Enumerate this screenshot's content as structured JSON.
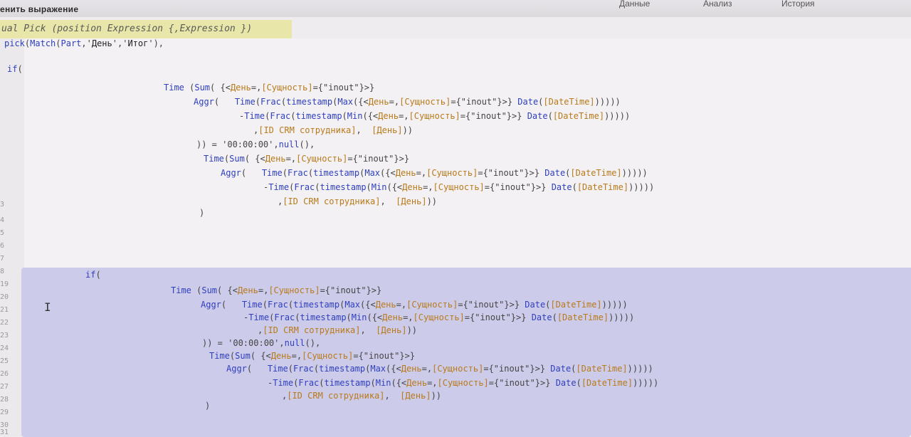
{
  "dialog": {
    "title": "енить выражение",
    "tabs": [
      "Данные",
      "Анализ",
      "История"
    ]
  },
  "hint": "ual Pick (position Expression {,Expression })",
  "colors": {
    "keyword": "#2e3fbf",
    "field": "#b87a1a",
    "selection": "#cdcbea",
    "hint_bg": "#e8e6a8"
  },
  "gutter": {
    "line_numbers": [
      "3",
      "4",
      "5",
      "6",
      "7",
      "8",
      "19",
      "20",
      "21",
      "22",
      "23",
      "24",
      "25",
      "26",
      "27",
      "28",
      "29",
      "30",
      "31"
    ]
  },
  "code": {
    "line1": [
      {
        "c": "fn",
        "t": "pick"
      },
      {
        "c": "txt",
        "t": "("
      },
      {
        "c": "fn",
        "t": "Match"
      },
      {
        "c": "txt",
        "t": "("
      },
      {
        "c": "fn",
        "t": "Part"
      },
      {
        "c": "txt",
        "t": ",'"
      },
      {
        "c": "str",
        "t": "День"
      },
      {
        "c": "txt",
        "t": "','"
      },
      {
        "c": "str",
        "t": "Итог"
      },
      {
        "c": "txt",
        "t": "'),"
      }
    ],
    "line2": [
      {
        "c": "kw",
        "t": "if"
      },
      {
        "c": "txt",
        "t": "("
      }
    ],
    "block_a": [
      [
        {
          "c": "fn",
          "t": "Time"
        },
        {
          "c": "txt",
          "t": " ("
        },
        {
          "c": "fn",
          "t": "Sum"
        },
        {
          "c": "txt",
          "t": "( {<"
        },
        {
          "c": "fld",
          "t": "День"
        },
        {
          "c": "txt",
          "t": "=,"
        },
        {
          "c": "fld",
          "t": "[Сущность]"
        },
        {
          "c": "txt",
          "t": "={\"inout\"}>}"
        }
      ],
      [
        {
          "c": "fn",
          "t": "Aggr"
        },
        {
          "c": "txt",
          "t": "(   "
        },
        {
          "c": "fn",
          "t": "Time"
        },
        {
          "c": "txt",
          "t": "("
        },
        {
          "c": "fn",
          "t": "Frac"
        },
        {
          "c": "txt",
          "t": "("
        },
        {
          "c": "fn",
          "t": "timestamp"
        },
        {
          "c": "txt",
          "t": "("
        },
        {
          "c": "fn",
          "t": "Max"
        },
        {
          "c": "txt",
          "t": "({<"
        },
        {
          "c": "fld",
          "t": "День"
        },
        {
          "c": "txt",
          "t": "=,"
        },
        {
          "c": "fld",
          "t": "[Сущность]"
        },
        {
          "c": "txt",
          "t": "={\"inout\"}>} "
        },
        {
          "c": "fn",
          "t": "Date"
        },
        {
          "c": "txt",
          "t": "("
        },
        {
          "c": "fld",
          "t": "[DateTime]"
        },
        {
          "c": "txt",
          "t": ")))))"
        }
      ],
      [
        {
          "c": "txt",
          "t": "-"
        },
        {
          "c": "fn",
          "t": "Time"
        },
        {
          "c": "txt",
          "t": "("
        },
        {
          "c": "fn",
          "t": "Frac"
        },
        {
          "c": "txt",
          "t": "("
        },
        {
          "c": "fn",
          "t": "timestamp"
        },
        {
          "c": "txt",
          "t": "("
        },
        {
          "c": "fn",
          "t": "Min"
        },
        {
          "c": "txt",
          "t": "({<"
        },
        {
          "c": "fld",
          "t": "День"
        },
        {
          "c": "txt",
          "t": "=,"
        },
        {
          "c": "fld",
          "t": "[Сущность]"
        },
        {
          "c": "txt",
          "t": "={\"inout\"}>} "
        },
        {
          "c": "fn",
          "t": "Date"
        },
        {
          "c": "txt",
          "t": "("
        },
        {
          "c": "fld",
          "t": "[DateTime]"
        },
        {
          "c": "txt",
          "t": ")))))"
        }
      ],
      [
        {
          "c": "txt",
          "t": ","
        },
        {
          "c": "fld",
          "t": "[ID CRM сотрудника]"
        },
        {
          "c": "txt",
          "t": ",  "
        },
        {
          "c": "fld",
          "t": "[День]"
        },
        {
          "c": "txt",
          "t": "))"
        }
      ],
      [
        {
          "c": "txt",
          "t": ")) = '00:00:00',"
        },
        {
          "c": "fn",
          "t": "null"
        },
        {
          "c": "txt",
          "t": "(),"
        }
      ],
      [
        {
          "c": "fn",
          "t": "Time"
        },
        {
          "c": "txt",
          "t": "("
        },
        {
          "c": "fn",
          "t": "Sum"
        },
        {
          "c": "txt",
          "t": "( {<"
        },
        {
          "c": "fld",
          "t": "День"
        },
        {
          "c": "txt",
          "t": "=,"
        },
        {
          "c": "fld",
          "t": "[Сущность]"
        },
        {
          "c": "txt",
          "t": "={\"inout\"}>}"
        }
      ],
      [
        {
          "c": "fn",
          "t": "Aggr"
        },
        {
          "c": "txt",
          "t": "(   "
        },
        {
          "c": "fn",
          "t": "Time"
        },
        {
          "c": "txt",
          "t": "("
        },
        {
          "c": "fn",
          "t": "Frac"
        },
        {
          "c": "txt",
          "t": "("
        },
        {
          "c": "fn",
          "t": "timestamp"
        },
        {
          "c": "txt",
          "t": "("
        },
        {
          "c": "fn",
          "t": "Max"
        },
        {
          "c": "txt",
          "t": "({<"
        },
        {
          "c": "fld",
          "t": "День"
        },
        {
          "c": "txt",
          "t": "=,"
        },
        {
          "c": "fld",
          "t": "[Сущность]"
        },
        {
          "c": "txt",
          "t": "={\"inout\"}>} "
        },
        {
          "c": "fn",
          "t": "Date"
        },
        {
          "c": "txt",
          "t": "("
        },
        {
          "c": "fld",
          "t": "[DateTime]"
        },
        {
          "c": "txt",
          "t": ")))))"
        }
      ],
      [
        {
          "c": "txt",
          "t": "-"
        },
        {
          "c": "fn",
          "t": "Time"
        },
        {
          "c": "txt",
          "t": "("
        },
        {
          "c": "fn",
          "t": "Frac"
        },
        {
          "c": "txt",
          "t": "("
        },
        {
          "c": "fn",
          "t": "timestamp"
        },
        {
          "c": "txt",
          "t": "("
        },
        {
          "c": "fn",
          "t": "Min"
        },
        {
          "c": "txt",
          "t": "({<"
        },
        {
          "c": "fld",
          "t": "День"
        },
        {
          "c": "txt",
          "t": "=,"
        },
        {
          "c": "fld",
          "t": "[Сущность]"
        },
        {
          "c": "txt",
          "t": "={\"inout\"}>} "
        },
        {
          "c": "fn",
          "t": "Date"
        },
        {
          "c": "txt",
          "t": "("
        },
        {
          "c": "fld",
          "t": "[DateTime]"
        },
        {
          "c": "txt",
          "t": ")))))"
        }
      ],
      [
        {
          "c": "txt",
          "t": ","
        },
        {
          "c": "fld",
          "t": "[ID CRM сотрудника]"
        },
        {
          "c": "txt",
          "t": ",  "
        },
        {
          "c": "fld",
          "t": "[День]"
        },
        {
          "c": "txt",
          "t": "))"
        }
      ],
      [
        {
          "c": "txt",
          "t": ")"
        }
      ]
    ],
    "if_line": [
      {
        "c": "kw",
        "t": "if"
      },
      {
        "c": "txt",
        "t": "("
      }
    ],
    "block_b": [
      [
        {
          "c": "fn",
          "t": "Time"
        },
        {
          "c": "txt",
          "t": " ("
        },
        {
          "c": "fn",
          "t": "Sum"
        },
        {
          "c": "txt",
          "t": "( {<"
        },
        {
          "c": "fld",
          "t": "День"
        },
        {
          "c": "txt",
          "t": "=,"
        },
        {
          "c": "fld",
          "t": "[Сущность]"
        },
        {
          "c": "txt",
          "t": "={\"inout\"}>}"
        }
      ],
      [
        {
          "c": "fn",
          "t": "Aggr"
        },
        {
          "c": "txt",
          "t": "(   "
        },
        {
          "c": "fn",
          "t": "Time"
        },
        {
          "c": "txt",
          "t": "("
        },
        {
          "c": "fn",
          "t": "Frac"
        },
        {
          "c": "txt",
          "t": "("
        },
        {
          "c": "fn",
          "t": "timestamp"
        },
        {
          "c": "txt",
          "t": "("
        },
        {
          "c": "fn",
          "t": "Max"
        },
        {
          "c": "txt",
          "t": "({<"
        },
        {
          "c": "fld",
          "t": "День"
        },
        {
          "c": "txt",
          "t": "=,"
        },
        {
          "c": "fld",
          "t": "[Сущность]"
        },
        {
          "c": "txt",
          "t": "={\"inout\"}>} "
        },
        {
          "c": "fn",
          "t": "Date"
        },
        {
          "c": "txt",
          "t": "("
        },
        {
          "c": "fld",
          "t": "[DateTime]"
        },
        {
          "c": "txt",
          "t": ")))))"
        }
      ],
      [
        {
          "c": "txt",
          "t": "-"
        },
        {
          "c": "fn",
          "t": "Time"
        },
        {
          "c": "txt",
          "t": "("
        },
        {
          "c": "fn",
          "t": "Frac"
        },
        {
          "c": "txt",
          "t": "("
        },
        {
          "c": "fn",
          "t": "timestamp"
        },
        {
          "c": "txt",
          "t": "("
        },
        {
          "c": "fn",
          "t": "Min"
        },
        {
          "c": "txt",
          "t": "({<"
        },
        {
          "c": "fld",
          "t": "День"
        },
        {
          "c": "txt",
          "t": "=,"
        },
        {
          "c": "fld",
          "t": "[Сущность]"
        },
        {
          "c": "txt",
          "t": "={\"inout\"}>} "
        },
        {
          "c": "fn",
          "t": "Date"
        },
        {
          "c": "txt",
          "t": "("
        },
        {
          "c": "fld",
          "t": "[DateTime]"
        },
        {
          "c": "txt",
          "t": ")))))"
        }
      ],
      [
        {
          "c": "txt",
          "t": ","
        },
        {
          "c": "fld",
          "t": "[ID CRM сотрудника]"
        },
        {
          "c": "txt",
          "t": ",  "
        },
        {
          "c": "fld",
          "t": "[День]"
        },
        {
          "c": "txt",
          "t": "))"
        }
      ],
      [
        {
          "c": "txt",
          "t": ")) = '00:00:00',"
        },
        {
          "c": "fn",
          "t": "null"
        },
        {
          "c": "txt",
          "t": "(),"
        }
      ],
      [
        {
          "c": "fn",
          "t": "Time"
        },
        {
          "c": "txt",
          "t": "("
        },
        {
          "c": "fn",
          "t": "Sum"
        },
        {
          "c": "txt",
          "t": "( {<"
        },
        {
          "c": "fld",
          "t": "День"
        },
        {
          "c": "txt",
          "t": "=,"
        },
        {
          "c": "fld",
          "t": "[Сущность]"
        },
        {
          "c": "txt",
          "t": "={\"inout\"}>}"
        }
      ],
      [
        {
          "c": "fn",
          "t": "Aggr"
        },
        {
          "c": "txt",
          "t": "(   "
        },
        {
          "c": "fn",
          "t": "Time"
        },
        {
          "c": "txt",
          "t": "("
        },
        {
          "c": "fn",
          "t": "Frac"
        },
        {
          "c": "txt",
          "t": "("
        },
        {
          "c": "fn",
          "t": "timestamp"
        },
        {
          "c": "txt",
          "t": "("
        },
        {
          "c": "fn",
          "t": "Max"
        },
        {
          "c": "txt",
          "t": "({<"
        },
        {
          "c": "fld",
          "t": "День"
        },
        {
          "c": "txt",
          "t": "=,"
        },
        {
          "c": "fld",
          "t": "[Сущность]"
        },
        {
          "c": "txt",
          "t": "={\"inout\"}>} "
        },
        {
          "c": "fn",
          "t": "Date"
        },
        {
          "c": "txt",
          "t": "("
        },
        {
          "c": "fld",
          "t": "[DateTime]"
        },
        {
          "c": "txt",
          "t": ")))))"
        }
      ],
      [
        {
          "c": "txt",
          "t": "-"
        },
        {
          "c": "fn",
          "t": "Time"
        },
        {
          "c": "txt",
          "t": "("
        },
        {
          "c": "fn",
          "t": "Frac"
        },
        {
          "c": "txt",
          "t": "("
        },
        {
          "c": "fn",
          "t": "timestamp"
        },
        {
          "c": "txt",
          "t": "("
        },
        {
          "c": "fn",
          "t": "Min"
        },
        {
          "c": "txt",
          "t": "({<"
        },
        {
          "c": "fld",
          "t": "День"
        },
        {
          "c": "txt",
          "t": "=,"
        },
        {
          "c": "fld",
          "t": "[Сущность]"
        },
        {
          "c": "txt",
          "t": "={\"inout\"}>} "
        },
        {
          "c": "fn",
          "t": "Date"
        },
        {
          "c": "txt",
          "t": "("
        },
        {
          "c": "fld",
          "t": "[DateTime]"
        },
        {
          "c": "txt",
          "t": ")))))"
        }
      ],
      [
        {
          "c": "txt",
          "t": ","
        },
        {
          "c": "fld",
          "t": "[ID CRM сотрудника]"
        },
        {
          "c": "txt",
          "t": ",  "
        },
        {
          "c": "fld",
          "t": "[День]"
        },
        {
          "c": "txt",
          "t": "))"
        }
      ],
      [
        {
          "c": "txt",
          "t": ")"
        }
      ]
    ]
  }
}
